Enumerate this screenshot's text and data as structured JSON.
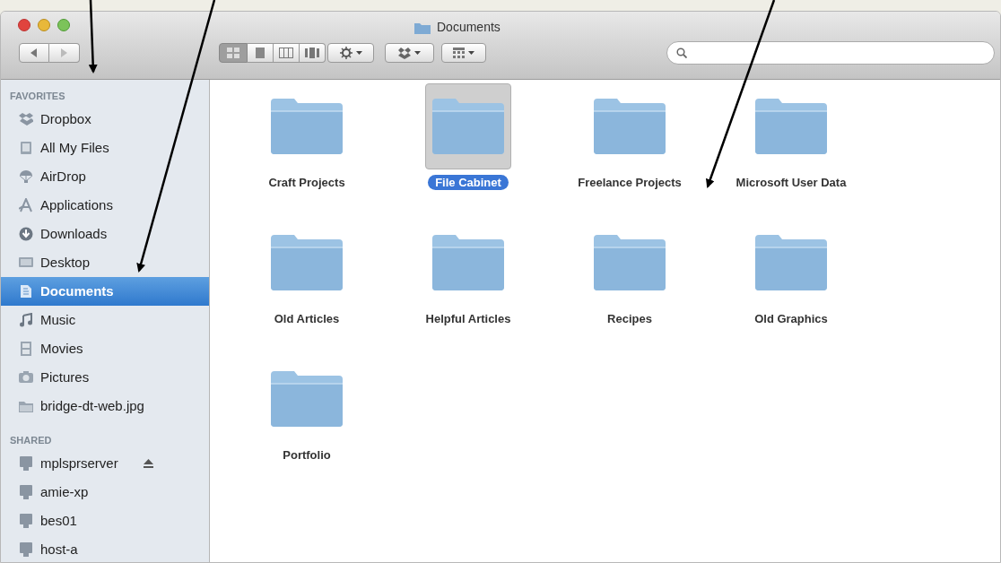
{
  "window": {
    "title": "Documents"
  },
  "sidebar": {
    "sections": [
      {
        "heading": "FAVORITES",
        "items": [
          {
            "label": "Dropbox",
            "kind": "dropbox",
            "selected": false
          },
          {
            "label": "All My Files",
            "kind": "files",
            "selected": false
          },
          {
            "label": "AirDrop",
            "kind": "airdrop",
            "selected": false
          },
          {
            "label": "Applications",
            "kind": "apps",
            "selected": false
          },
          {
            "label": "Downloads",
            "kind": "download",
            "selected": false
          },
          {
            "label": "Desktop",
            "kind": "desktop",
            "selected": false
          },
          {
            "label": "Documents",
            "kind": "documents",
            "selected": true
          },
          {
            "label": "Music",
            "kind": "music",
            "selected": false
          },
          {
            "label": "Movies",
            "kind": "movies",
            "selected": false
          },
          {
            "label": "Pictures",
            "kind": "camera",
            "selected": false
          },
          {
            "label": "bridge-dt-web.jpg",
            "kind": "folder",
            "selected": false
          }
        ]
      },
      {
        "heading": "SHARED",
        "items": [
          {
            "label": "mplsprserver",
            "kind": "server",
            "selected": false,
            "eject": true
          },
          {
            "label": "amie-xp",
            "kind": "server",
            "selected": false,
            "eject": false
          },
          {
            "label": "bes01",
            "kind": "server",
            "selected": false,
            "eject": false
          },
          {
            "label": "host-a",
            "kind": "server",
            "selected": false,
            "eject": false
          }
        ]
      }
    ]
  },
  "folders": [
    {
      "name": "Craft Projects",
      "selected": false
    },
    {
      "name": "File Cabinet",
      "selected": true
    },
    {
      "name": "Freelance Projects",
      "selected": false
    },
    {
      "name": "Microsoft User Data",
      "selected": false
    },
    {
      "name": "Old Articles",
      "selected": false
    },
    {
      "name": "Helpful Articles",
      "selected": false
    },
    {
      "name": "Recipes",
      "selected": false
    },
    {
      "name": "Old Graphics",
      "selected": false
    },
    {
      "name": "Portfolio",
      "selected": false
    }
  ]
}
